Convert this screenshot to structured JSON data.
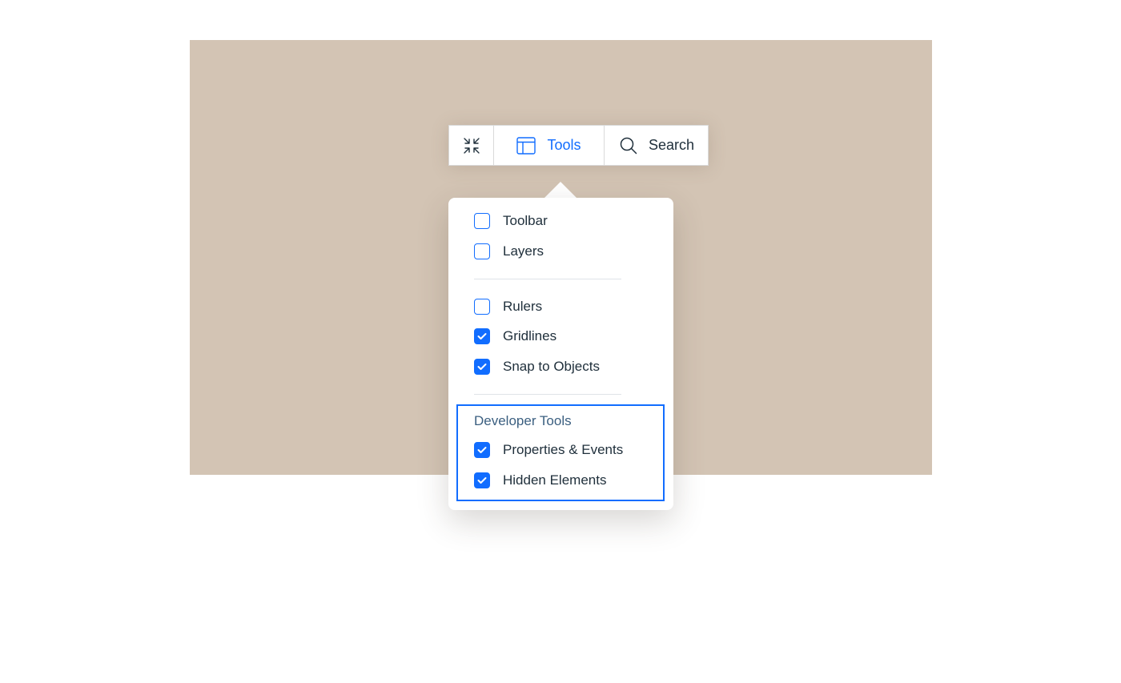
{
  "toolbar": {
    "collapse_icon": "collapse-icon",
    "tools": {
      "label": "Tools",
      "icon": "layout-panel-icon"
    },
    "search": {
      "label": "Search",
      "icon": "search-icon"
    }
  },
  "dropdown": {
    "groups": [
      {
        "items": [
          {
            "label": "Toolbar",
            "checked": false
          },
          {
            "label": "Layers",
            "checked": false
          }
        ]
      },
      {
        "items": [
          {
            "label": "Rulers",
            "checked": false
          },
          {
            "label": "Gridlines",
            "checked": true
          },
          {
            "label": "Snap to Objects",
            "checked": true
          }
        ]
      },
      {
        "title": "Developer Tools",
        "items": [
          {
            "label": "Properties & Events",
            "checked": true
          },
          {
            "label": "Hidden Elements",
            "checked": true
          }
        ]
      }
    ]
  },
  "colors": {
    "accent": "#116dff",
    "stage": "#d3c4b4",
    "text": "#20303c",
    "section_title": "#3b5f80"
  }
}
